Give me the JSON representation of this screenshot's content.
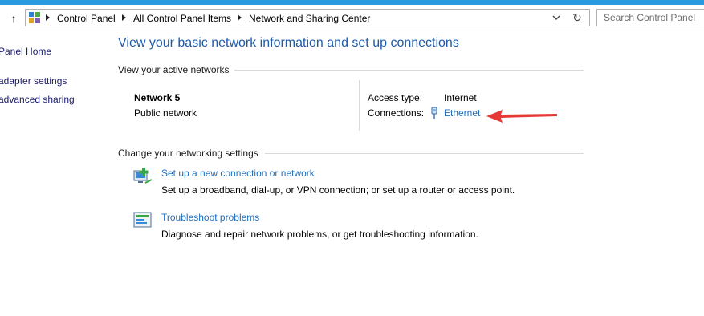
{
  "address_bar": {
    "breadcrumbs": [
      "Control Panel",
      "All Control Panel Items",
      "Network and Sharing Center"
    ]
  },
  "search": {
    "placeholder": "Search Control Panel"
  },
  "sidebar": {
    "items": [
      {
        "label": "Panel Home"
      },
      {
        "label": "adapter settings"
      },
      {
        "label": "advanced sharing"
      }
    ]
  },
  "main": {
    "title": "View your basic network information and set up connections",
    "active_networks": {
      "heading": "View your active networks",
      "network_name": "Network  5",
      "network_type": "Public network",
      "access_type_label": "Access type:",
      "access_type_value": "Internet",
      "connections_label": "Connections:",
      "connections_value": "Ethernet"
    },
    "settings": {
      "heading": "Change your networking settings",
      "tasks": [
        {
          "title": "Set up a new connection or network",
          "description": "Set up a broadband, dial-up, or VPN connection; or set up a router or access point.",
          "icon": "new-connection-icon"
        },
        {
          "title": "Troubleshoot problems",
          "description": "Diagnose and repair network problems, or get troubleshooting information.",
          "icon": "troubleshoot-icon"
        }
      ]
    }
  },
  "colors": {
    "accent": "#2b9ae0",
    "title": "#1e5aa8",
    "link": "#1e6fc1",
    "annotation": "#e53935"
  }
}
